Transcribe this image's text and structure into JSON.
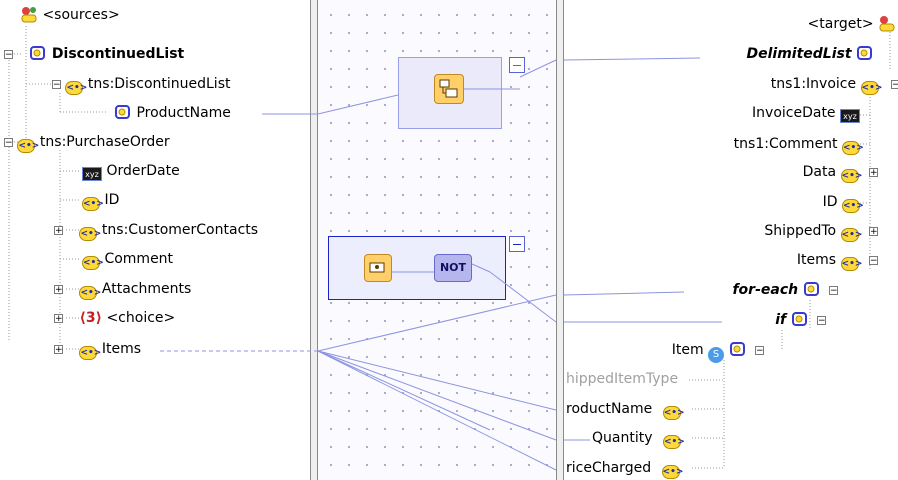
{
  "sources_label": "<sources>",
  "target_label": "<target>",
  "source_tree": [
    {
      "label": "DiscontinuedList"
    },
    {
      "label": "tns:DiscontinuedList"
    },
    {
      "label": "ProductName"
    },
    {
      "label": "tns:PurchaseOrder"
    },
    {
      "label": "OrderDate"
    },
    {
      "label": "ID"
    },
    {
      "label": "tns:CustomerContacts"
    },
    {
      "label": "Comment"
    },
    {
      "label": "Attachments"
    },
    {
      "label": "<choice>"
    },
    {
      "label": "Items"
    }
  ],
  "target_tree": [
    {
      "label": "DelimitedList"
    },
    {
      "label": "tns1:Invoice"
    },
    {
      "label": "InvoiceDate"
    },
    {
      "label": "tns1:Comment"
    },
    {
      "label": "Data"
    },
    {
      "label": "ID"
    },
    {
      "label": "ShippedTo"
    },
    {
      "label": "Items"
    },
    {
      "label": "for-each"
    },
    {
      "label": "if"
    },
    {
      "label": "Item"
    },
    {
      "label": "hippedItemType"
    },
    {
      "label": "roductName"
    },
    {
      "label": "Quantity"
    },
    {
      "label": "riceCharged"
    }
  ],
  "functions": {
    "not_label": "NOT",
    "type_badge": "xyz"
  },
  "colors": {
    "element_icon": "#ffd93a",
    "wire": "#8c94e0",
    "function_box_border": "#5a62d8",
    "function_box_fill": "#e8eaff",
    "canvas_dot": "#a8a8c8"
  }
}
